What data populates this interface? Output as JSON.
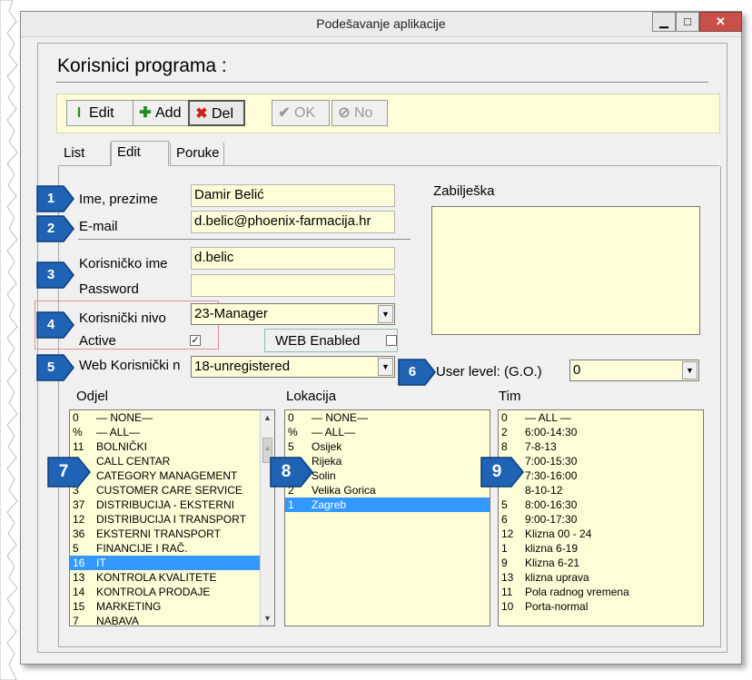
{
  "window": {
    "title": "Podešavanje aplikacije",
    "controls": {
      "minimize": "▁",
      "maximize": "□",
      "close": "✕"
    }
  },
  "heading": "Korisnici programa :",
  "toolbar": {
    "edit": "Edit",
    "add": "Add",
    "del": "Del",
    "ok": "OK",
    "no": "No"
  },
  "tabs": [
    "List",
    "Edit",
    "Poruke"
  ],
  "active_tab": "Edit",
  "form": {
    "name_label": "Ime, prezime",
    "name_value": "Damir Belić",
    "email_label": "E-mail",
    "email_value": "d.belic@phoenix-farmacija.hr",
    "username_label": "Korisničko ime",
    "username_value": "d.belic",
    "password_label": "Password",
    "password_value": "",
    "level_label": "Korisnički nivo",
    "level_value": "23-Manager",
    "active_label": "Active",
    "active_checked": true,
    "active_mark": "✓",
    "web_enabled_label": "WEB Enabled",
    "web_enabled_checked": false,
    "web_user_label": "Web Korisnički n",
    "web_user_value": "18-unregistered",
    "user_level_label": "User level: (G.O.)",
    "user_level_value": "0",
    "note_label": "Zabilješka"
  },
  "odjel": {
    "label": "Odjel",
    "items": [
      {
        "code": "0",
        "name": "— NONE—"
      },
      {
        "code": "%",
        "name": "— ALL—"
      },
      {
        "code": "11",
        "name": "BOLNIČKI"
      },
      {
        "code": "",
        "name": "CALL CENTAR"
      },
      {
        "code": "",
        "name": "CATEGORY MANAGEMENT"
      },
      {
        "code": "3",
        "name": "CUSTOMER CARE SERVICE"
      },
      {
        "code": "37",
        "name": "DISTRIBUCIJA - EKSTERNI"
      },
      {
        "code": "12",
        "name": "DISTRIBUCIJA I TRANSPORT"
      },
      {
        "code": "36",
        "name": "EKSTERNI TRANSPORT"
      },
      {
        "code": "5",
        "name": "FINANCIJE I RAČ."
      },
      {
        "code": "16",
        "name": "IT"
      },
      {
        "code": "13",
        "name": "KONTROLA KVALITETE"
      },
      {
        "code": "14",
        "name": "KONTROLA PRODAJE"
      },
      {
        "code": "15",
        "name": "MARKETING"
      },
      {
        "code": "7",
        "name": "NABAVA"
      }
    ],
    "selected": "IT"
  },
  "lokacija": {
    "label": "Lokacija",
    "items": [
      {
        "code": "0",
        "name": "— NONE—"
      },
      {
        "code": "%",
        "name": "— ALL—"
      },
      {
        "code": "5",
        "name": "Osijek"
      },
      {
        "code": "",
        "name": "Rijeka"
      },
      {
        "code": "",
        "name": "Solin"
      },
      {
        "code": "2",
        "name": "Velika Gorica"
      },
      {
        "code": "1",
        "name": "Zagreb"
      }
    ],
    "selected": "Zagreb"
  },
  "tim": {
    "label": "Tim",
    "items": [
      {
        "code": "0",
        "name": "— ALL —"
      },
      {
        "code": "2",
        "name": "6:00-14:30"
      },
      {
        "code": "8",
        "name": "7-8-13"
      },
      {
        "code": "",
        "name": "7:00-15:30"
      },
      {
        "code": "",
        "name": "7:30-16:00"
      },
      {
        "code": "",
        "name": "8-10-12"
      },
      {
        "code": "5",
        "name": "8:00-16:30"
      },
      {
        "code": "6",
        "name": "9:00-17:30"
      },
      {
        "code": "12",
        "name": "Klizna 00 - 24"
      },
      {
        "code": "1",
        "name": "klizna 6-19"
      },
      {
        "code": "9",
        "name": "Klizna 6-21"
      },
      {
        "code": "13",
        "name": "klizna uprava"
      },
      {
        "code": "11",
        "name": "Pola radnog vremena"
      },
      {
        "code": "10",
        "name": "Porta-normal"
      }
    ]
  },
  "scrollbar": {
    "up": "▲",
    "down": "▼",
    "grip": "≡"
  },
  "combo_arrow": "▼",
  "badges": [
    "1",
    "2",
    "3",
    "4",
    "5",
    "6",
    "7",
    "8",
    "9"
  ],
  "colors": {
    "field_bg": "#fdfdd7",
    "selection": "#3399ff",
    "badge": "#1e63b4",
    "close_button": "#c7504a"
  }
}
